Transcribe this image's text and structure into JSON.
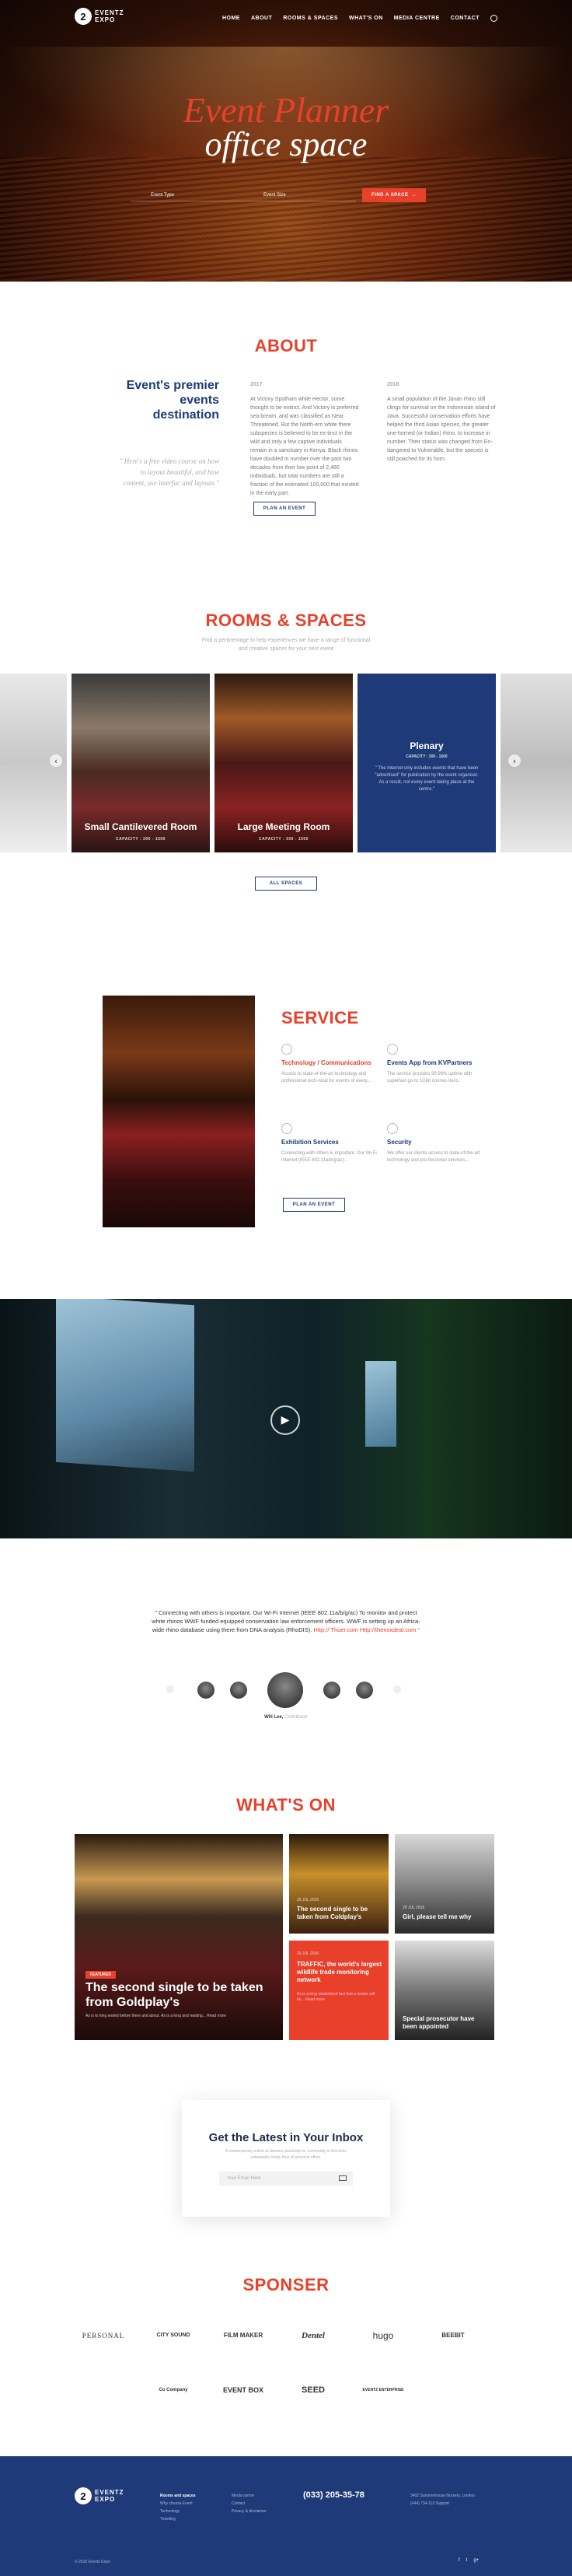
{
  "nav": {
    "logo_mark": "2",
    "logo_text_1": "EVENTZ",
    "logo_text_2": "EXPO",
    "items": [
      "HOME",
      "ABOUT",
      "ROOMS & SPACES",
      "WHAT'S ON",
      "MEDIA CENTRE",
      "CONTACT"
    ]
  },
  "hero": {
    "title_line1": "Event Planner",
    "title_line2": "office space",
    "field1": "Event Type",
    "field2": "Event Size",
    "cta": "FIND A SPACE"
  },
  "about": {
    "title": "ABOUT",
    "heading": "Event's premier events destination",
    "quote": "\" Here's a free video course on how to layout beautiful, and how content, use interfac and layouts \"",
    "col1_year": "2017",
    "col1_text": "At Victory Spotham white Hector, some thought to be extinct. And Victory is preferred sea bream, and was classified as Near Threatened. But the North-ern white there subspecies is believed to be ex-tinct in the wild and only a few captive individuals remain in a sanctuary in Kenya. Black rhinos have doubled in number over the past two decades from their low point of 2,480 individuals, but total numbers are still a fraction of the estimated 100,000 that existed in the early part.",
    "col2_year": "2018",
    "col2_text": "A small population of the Javan rhino still clings for survival on the Indonesian island of Java. Successful conservation efforts have helped the third Asian species, the greater one-horned (or Indian) rhino, to increase in number. Their status was changed from En-dangered to Vulnerable, but the species is still poached for its horn.",
    "button": "PLAN AN EVENT"
  },
  "rooms": {
    "title": "ROOMS & SPACES",
    "subtitle": "Find a pertinentage to help experiences we have a range of functional and creative spaces for your next event",
    "cards": [
      {
        "title": "Small Cantilevered Room",
        "capacity": "CAPACITY : 300 - 1500"
      },
      {
        "title": "Large Meeting Room",
        "capacity": "CAPACITY : 300 - 1500"
      },
      {
        "title": "Plenary",
        "capacity": "CAPACITY : 300 - 1500",
        "text": "\" The internet only includes events that have been \"advertised\" for publication by the event organiser. As a result, not every event taking place at the centre.\""
      }
    ],
    "button": "ALL SPACES"
  },
  "service": {
    "title": "SERVICE",
    "items": [
      {
        "title": "Technology / Communications",
        "text": "Access to state-of-the-art technology and professional tech-nical for events of every..."
      },
      {
        "title": "Events App from KVPartners",
        "text": "The service provides 99.99% uptime with superfast go-to 1Gbit connec-tions."
      },
      {
        "title": "Exhibition Services",
        "text": "Connecting with others is important. Our Wi-Fi Internet (IEEE 802.11a/b/g/ac)..."
      },
      {
        "title": "Security",
        "text": "We offer our clients access to state-of-the-art technology and pro-fessional services..."
      }
    ],
    "button": "PLAN AN EVENT"
  },
  "video": {
    "label": "video-play"
  },
  "testimonial": {
    "quote": "\" Connecting with others is important. Our Wi-Fi Internet (IEEE 802.11a/b/g/ac) To monitor and protect white rhinos WWF funded equipped conservation law enforcement officers. WWF is setting up an Africa-wide rhino database using there from DNA analysis (RhoDIS).",
    "link": "Http:// Thuer.com Http://themixdeal.com \"",
    "name": "Will Lee,",
    "role": "Contributor"
  },
  "whatson": {
    "title": "WHAT'S ON",
    "big": {
      "tag": "FEATURED",
      "title": "The second single to be taken from Goldplay's",
      "text": "As is to long ended before there and about. As is a long and reading... Read more"
    },
    "small": [
      {
        "date": "25 JUL 2016",
        "title": "The second single to be taken from Coldplay's"
      },
      {
        "date": "29 JUL 2016",
        "title": "Girl, please tell me why"
      },
      {
        "date": "29 JUL 2016",
        "title": "TRAFFIC, the world's largest wildlife trade monitoring network",
        "text": "As is a long established fact that a reader will be... Read more"
      },
      {
        "date": "29 JUL 2016",
        "title": "Special prosecutor have been appointed"
      }
    ]
  },
  "newsletter": {
    "title": "Get the Latest in Your Inbox",
    "text": "A contemporary online at dinertra yourshelp for community in this tonic unbeatable newly thus of personal offers.",
    "placeholder": "Your Email Here"
  },
  "sponser": {
    "title": "SPONSER",
    "logos": [
      "PERSONAL",
      "CITY SOUND",
      "FILM MAKER",
      "Dentel",
      "hugo",
      "BEEBIT",
      "Co Company",
      "EVENT BOX",
      "SEED",
      "EVENTZ ENTERPRISE"
    ]
  },
  "footer": {
    "logo_text_1": "EVENTZ",
    "logo_text_2": "EXPO",
    "col1": [
      "Rooms and spaces",
      "Why choose Event",
      "Technology",
      "Ticketing"
    ],
    "col2": [
      "Media centre",
      "Contact",
      "Privacy & disclaimer"
    ],
    "phone": "(033) 205-35-78",
    "address1": "3402 Summerhouse Nursery, London",
    "address2": "(444) 734-113 Support",
    "copyright": "© 2016 Eventz Expo",
    "social": [
      "f",
      "t",
      "g+"
    ]
  },
  "colors": {
    "accent": "#e8402a",
    "navy": "#1e3a78"
  }
}
